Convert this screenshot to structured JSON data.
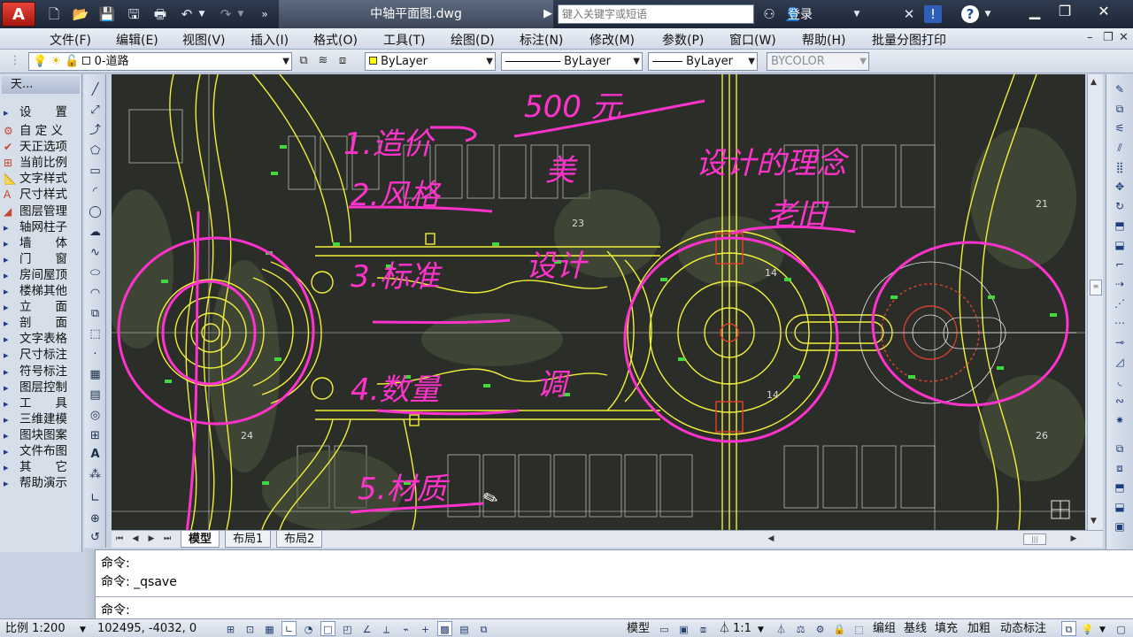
{
  "window": {
    "title": "中轴平面图.dwg",
    "search_placeholder": "键入关键字或短语",
    "login_label": "登录",
    "app_logo": "A"
  },
  "menu": [
    "文件(F)",
    "编辑(E)",
    "视图(V)",
    "插入(I)",
    "格式(O)",
    "工具(T)",
    "绘图(D)",
    "标注(N)",
    "修改(M)",
    "参数(P)",
    "窗口(W)",
    "帮助(H)",
    "批量分图打印"
  ],
  "layer_toolbar": {
    "current_layer": "0-道路",
    "color": "ByLayer",
    "linetype": "ByLayer",
    "lineweight": "ByLayer",
    "plot_style": "BYCOLOR"
  },
  "tarch_panel": {
    "title": "天...",
    "items": [
      {
        "label": "设　　置",
        "kind": "head"
      },
      {
        "label": "自 定 义",
        "kind": "sub"
      },
      {
        "label": "天正选项",
        "kind": "sub"
      },
      {
        "label": "当前比例",
        "kind": "sub"
      },
      {
        "label": "文字样式",
        "kind": "sub"
      },
      {
        "label": "尺寸样式",
        "kind": "sub"
      },
      {
        "label": "图层管理",
        "kind": "sub"
      },
      {
        "label": "轴网柱子",
        "kind": "head"
      },
      {
        "label": "墙　　体",
        "kind": "head"
      },
      {
        "label": "门　　窗",
        "kind": "head"
      },
      {
        "label": "房间屋顶",
        "kind": "head"
      },
      {
        "label": "楼梯其他",
        "kind": "head"
      },
      {
        "label": "立　　面",
        "kind": "head"
      },
      {
        "label": "剖　　面",
        "kind": "head"
      },
      {
        "label": "文字表格",
        "kind": "head"
      },
      {
        "label": "尺寸标注",
        "kind": "head"
      },
      {
        "label": "符号标注",
        "kind": "head"
      },
      {
        "label": "图层控制",
        "kind": "head"
      },
      {
        "label": "工　　具",
        "kind": "head"
      },
      {
        "label": "三维建模",
        "kind": "head"
      },
      {
        "label": "图块图案",
        "kind": "head"
      },
      {
        "label": "文件布图",
        "kind": "head"
      },
      {
        "label": "其　　它",
        "kind": "head"
      },
      {
        "label": "帮助演示",
        "kind": "head"
      }
    ]
  },
  "tabs": [
    "模型",
    "布局1",
    "布局2"
  ],
  "active_tab": "模型",
  "command": {
    "history": [
      "命令:",
      "命令: _qsave"
    ],
    "prompt": "命令:"
  },
  "status": {
    "scale": "比例 1:200",
    "coords": "102495, -4032, 0",
    "model": "模型",
    "annotation_scale": "1:1",
    "toggles": [
      "编组",
      "基线",
      "填充",
      "加粗",
      "动态标注"
    ]
  },
  "annotations": {
    "n1": "1.造价",
    "n1b": "500 元",
    "n2": "2.风格",
    "n2b": "美",
    "n3": "3.标准",
    "n4": "4.数量",
    "n4b": "调",
    "n5": "5.材质",
    "r1": "设计的理念",
    "r2": "老旧",
    "m1": "设计"
  },
  "drawing_labels": {
    "p21": "21",
    "p23": "23",
    "p24": "24",
    "p14a": "14",
    "p14b": "14",
    "p26": "26"
  }
}
